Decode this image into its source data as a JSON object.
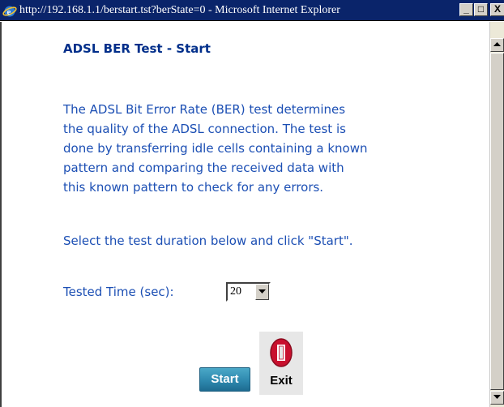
{
  "window": {
    "title": "http://192.168.1.1/berstart.tst?berState=0 - Microsoft Internet Explorer",
    "icon": "ie-icon",
    "controls": {
      "minimize": "_",
      "maximize": "□",
      "close": "X"
    }
  },
  "page": {
    "heading": "ADSL BER Test - Start",
    "paragraph_lines": [
      "The ADSL Bit Error Rate (BER) test determines",
      "the quality of the ADSL connection. The test is",
      "done by transferring idle cells containing a known",
      "pattern and comparing the received data with",
      "this known pattern to check for any errors."
    ],
    "instruction": "Select the test duration below and click \"Start\".",
    "tested_time_label": "Tested Time (sec):",
    "tested_time_value": "20",
    "start_label": "Start",
    "exit_label": "Exit"
  },
  "colors": {
    "heading": "#002e8a",
    "body_text": "#1c4fb4",
    "titlebar": "#0a246a",
    "start_button": "#2c86ac",
    "exit_icon": "#c8102e"
  }
}
